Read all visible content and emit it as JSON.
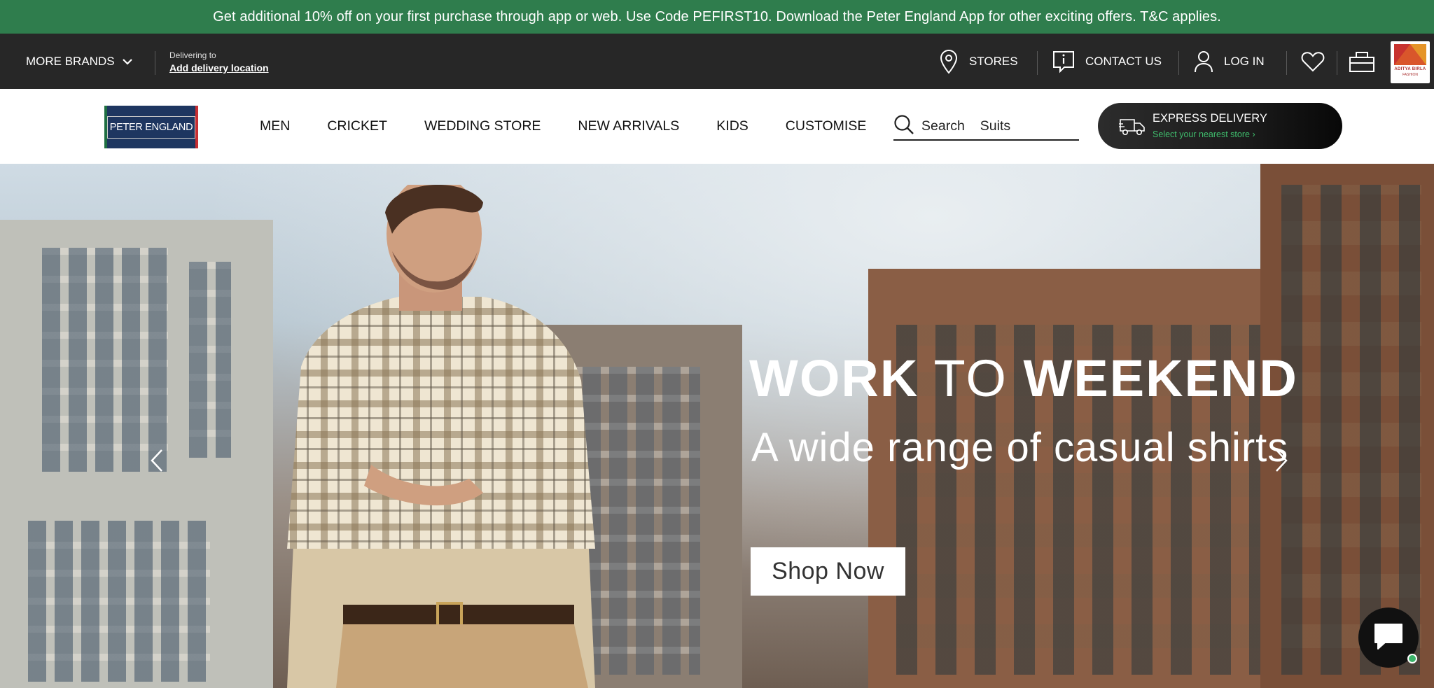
{
  "promo": {
    "text": "Get additional 10% off on your first purchase through app or web. Use Code PEFIRST10. Download the Peter England App for other exciting offers. T&C applies."
  },
  "utility_bar": {
    "more_brands": "MORE BRANDS",
    "delivering_to": "Delivering to",
    "add_location": "Add delivery location",
    "stores": "STORES",
    "contact": "CONTACT US",
    "login": "LOG IN",
    "group_logo": {
      "line1": "ADITYA BIRLA",
      "line2": "FASHION"
    }
  },
  "nav": {
    "logo_text": "PETER ENGLAND",
    "menu": [
      "MEN",
      "CRICKET",
      "WEDDING STORE",
      "NEW ARRIVALS",
      "KIDS",
      "CUSTOMISE"
    ],
    "search_label": "Search",
    "search_value": "Suits",
    "express": {
      "title": "EXPRESS DELIVERY",
      "subtitle": "Select your nearest store"
    }
  },
  "hero": {
    "headline_bold_1": "WORK",
    "headline_light": "TO",
    "headline_bold_2": "WEEKEND",
    "subline": "A wide range of casual shirts",
    "cta": "Shop Now"
  },
  "colors": {
    "promo_bg": "#2f7d4d",
    "utility_bg": "#272727",
    "express_accent": "#3fbe6d"
  },
  "icons": [
    "chevron-down-icon",
    "location-pin-icon",
    "info-icon",
    "user-icon",
    "heart-icon",
    "bag-icon",
    "search-icon",
    "truck-icon",
    "chevron-left-icon",
    "chevron-right-icon",
    "chat-icon"
  ]
}
